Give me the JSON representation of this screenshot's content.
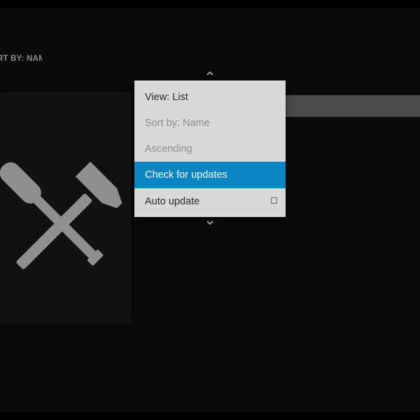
{
  "header": {
    "sort_label": "RT BY: NAM"
  },
  "context_menu": {
    "items": [
      {
        "label": "View: List",
        "state": "enabled"
      },
      {
        "label": "Sort by: Name",
        "state": "disabled"
      },
      {
        "label": "Ascending",
        "state": "disabled"
      },
      {
        "label": "Check for updates",
        "state": "selected"
      },
      {
        "label": "Auto update",
        "state": "enabled",
        "checked": false
      }
    ]
  },
  "icons": {
    "thumbnail": "tools-icon",
    "scroll_up": "chevron-up-icon",
    "scroll_down": "chevron-down-icon",
    "checkbox": "checkbox-icon"
  },
  "colors": {
    "background": "#0a0a0a",
    "menu_background": "#d9d9d9",
    "selected": "#0b84c2",
    "icon": "#8f8f8f"
  }
}
